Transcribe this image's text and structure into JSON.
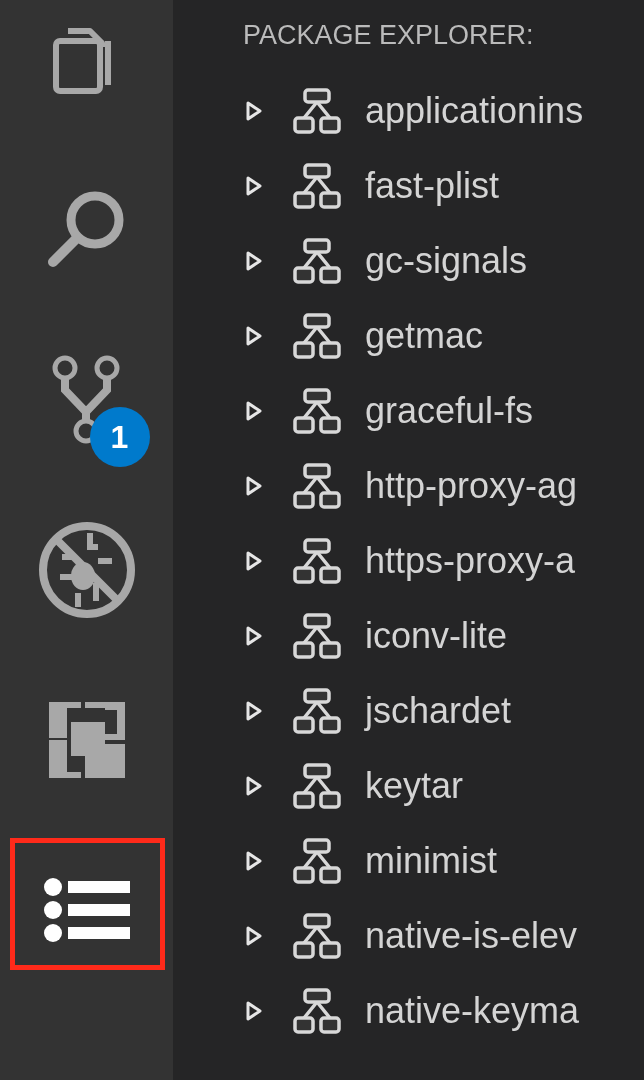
{
  "activity_bar": {
    "items": [
      {
        "kind": "files",
        "selected": false
      },
      {
        "kind": "search",
        "selected": false
      },
      {
        "kind": "source-control",
        "selected": false,
        "badge": "1"
      },
      {
        "kind": "debug",
        "selected": false
      },
      {
        "kind": "extensions",
        "selected": false
      },
      {
        "kind": "outline",
        "selected": true,
        "highlighted": true
      }
    ]
  },
  "sidebar": {
    "title": "PACKAGE EXPLORER:",
    "items": [
      {
        "label": "applicationins",
        "expanded": false
      },
      {
        "label": "fast-plist",
        "expanded": false
      },
      {
        "label": "gc-signals",
        "expanded": false
      },
      {
        "label": "getmac",
        "expanded": false
      },
      {
        "label": "graceful-fs",
        "expanded": false
      },
      {
        "label": "http-proxy-ag",
        "expanded": false
      },
      {
        "label": "https-proxy-a",
        "expanded": false
      },
      {
        "label": "iconv-lite",
        "expanded": false
      },
      {
        "label": "jschardet",
        "expanded": false
      },
      {
        "label": "keytar",
        "expanded": false
      },
      {
        "label": "minimist",
        "expanded": false
      },
      {
        "label": "native-is-elev",
        "expanded": false
      },
      {
        "label": "native-keyma",
        "expanded": false
      }
    ]
  }
}
